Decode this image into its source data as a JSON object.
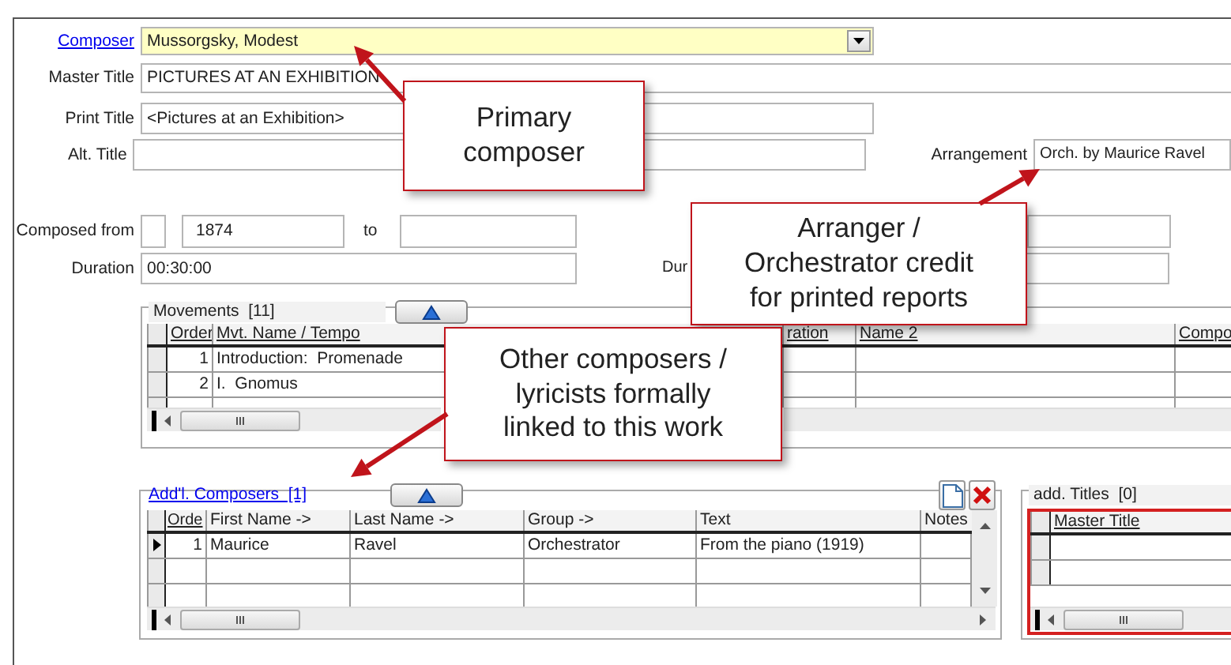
{
  "composer": {
    "label": "Composer",
    "value": "Mussorgsky, Modest"
  },
  "master_title": {
    "label": "Master Title",
    "value": "PICTURES AT AN EXHIBITION"
  },
  "print_title": {
    "label": "Print Title",
    "value": "<Pictures at an Exhibition>"
  },
  "alt_title": {
    "label": "Alt. Title"
  },
  "arrangement": {
    "label": "Arrangement",
    "value": "Orch. by Maurice Ravel"
  },
  "composed_from": {
    "label": "Composed from",
    "value": "1874",
    "to_label": "to"
  },
  "duration": {
    "label": "Duration",
    "value": "00:30:00"
  },
  "duration_2": {
    "label": "Dur"
  },
  "movements": {
    "title": "Movements  [11]",
    "columns": [
      "Order",
      "Mvt. Name / Tempo",
      "ration",
      "Name 2",
      "Compo"
    ],
    "rows": [
      {
        "cells": [
          "1",
          "Introduction:  Promenade"
        ]
      },
      {
        "cells": [
          "2",
          "I.  Gnomus"
        ]
      }
    ]
  },
  "additional_composers": {
    "title": "Add'l. Composers  [1]",
    "columns": [
      "Orde",
      "First Name ->",
      "Last Name ->",
      "Group ->",
      "Text",
      "Notes"
    ],
    "rows": [
      {
        "current": true,
        "cells": [
          "1",
          "Maurice",
          "Ravel",
          "Orchestrator",
          "From the piano (1919)"
        ]
      }
    ]
  },
  "additional_titles": {
    "title": "add. Titles  [0]",
    "columns": [
      "Master Title"
    ]
  },
  "callouts": [
    {
      "lines": [
        "Primary",
        "composer"
      ]
    },
    {
      "lines": [
        "Arranger /",
        "Orchestrator credit",
        "for printed reports"
      ]
    },
    {
      "lines": [
        "Other composers /",
        "lyricists formally",
        "linked to this work"
      ]
    }
  ]
}
